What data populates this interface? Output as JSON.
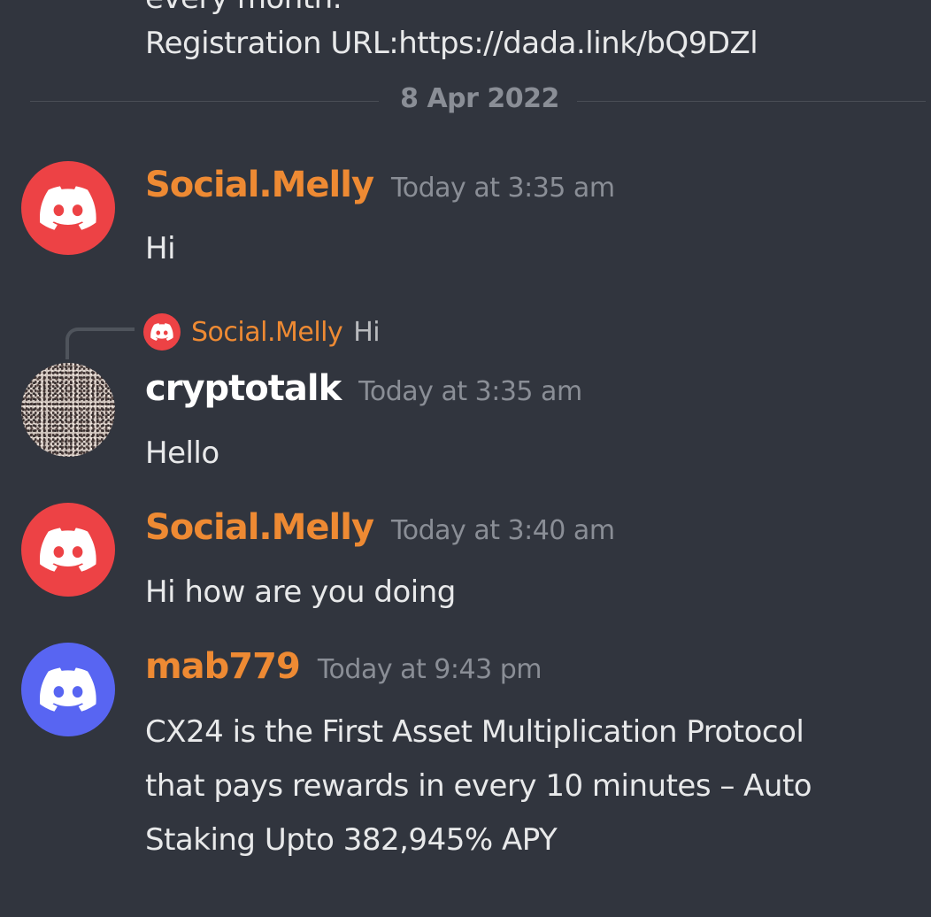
{
  "top_partial": {
    "cut_text": "every month.",
    "registration_line": "Registration URL:https://dada.link/bQ9DZl"
  },
  "date_divider": {
    "label": "8 Apr 2022"
  },
  "messages": [
    {
      "username": "Social.Melly",
      "timestamp": "Today at 3:35 am",
      "text": "Hi",
      "avatar_color": "#ed4245",
      "avatar_icon": "discord-logo-icon",
      "name_color": "#ee8a33"
    },
    {
      "reply": {
        "username": "Social.Melly",
        "text": "Hi"
      },
      "username": "cryptotalk",
      "timestamp": "Today at 3:35 am",
      "text": "Hello",
      "avatar_icon": "user-photo-avatar",
      "name_color": "#ffffff"
    },
    {
      "username": "Social.Melly",
      "timestamp": "Today at 3:40 am",
      "text": "Hi how are you doing",
      "avatar_color": "#ed4245",
      "avatar_icon": "discord-logo-icon",
      "name_color": "#ee8a33"
    },
    {
      "username": "mab779",
      "timestamp": "Today at 9:43 pm",
      "text_lines": [
        "CX24 is the First Asset Multiplication Protocol",
        "that pays rewards in every 10 minutes – Auto",
        "Staking Upto 382,945% APY"
      ],
      "avatar_color": "#5865f2",
      "avatar_icon": "discord-logo-icon",
      "name_color": "#ee8a33"
    }
  ],
  "colors": {
    "background": "#31353e",
    "divider": "#4a4e56",
    "timestamp": "#8a8e96",
    "message_text": "#e8e9ea"
  }
}
